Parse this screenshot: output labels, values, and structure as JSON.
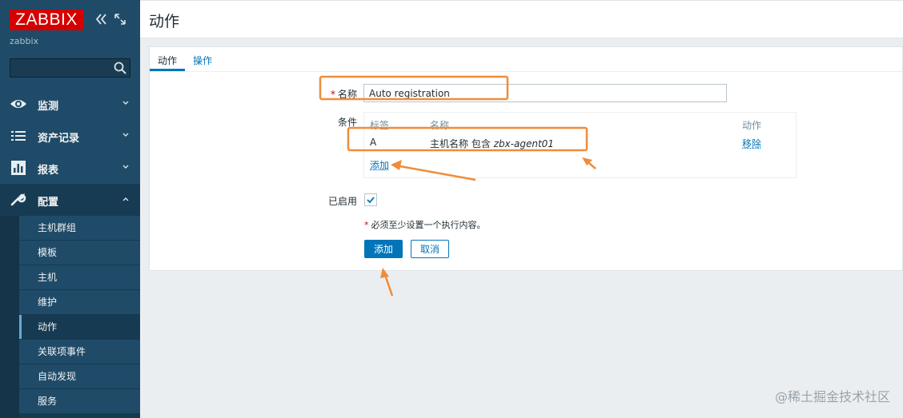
{
  "sidebar": {
    "logo": "ZABBIX",
    "server_name": "zabbix",
    "search": {
      "value": "",
      "placeholder": ""
    },
    "menu": [
      {
        "label": "监测",
        "icon": "eye-icon"
      },
      {
        "label": "资产记录",
        "icon": "list-icon"
      },
      {
        "label": "报表",
        "icon": "bar-chart-icon"
      },
      {
        "label": "配置",
        "icon": "wrench-icon"
      }
    ],
    "submenu": [
      "主机群组",
      "模板",
      "主机",
      "维护",
      "动作",
      "关联项事件",
      "自动发现",
      "服务"
    ],
    "selected_submenu": "动作"
  },
  "header": {
    "title": "动作"
  },
  "tabs": [
    "动作",
    "操作"
  ],
  "form": {
    "name_label": "名称",
    "name_value": "Auto registration",
    "conditions_label": "条件",
    "conditions": {
      "headers": {
        "tag": "标签",
        "name": "名称",
        "action": "动作"
      },
      "rows": [
        {
          "tag": "A",
          "name_prefix": "主机名称 包含 ",
          "name_value": "zbx-agent01",
          "action": "移除"
        }
      ],
      "add_link": "添加"
    },
    "enabled_label": "已启用",
    "enabled": true,
    "note": "必须至少设置一个执行内容。",
    "submit_button": "添加",
    "cancel_button": "取消"
  },
  "colors": {
    "sidebar": "#1f4b68",
    "accent": "#0275b8",
    "logo": "#d40000",
    "annotation": "#f08c3a"
  },
  "watermark": "@稀土掘金技术社区"
}
